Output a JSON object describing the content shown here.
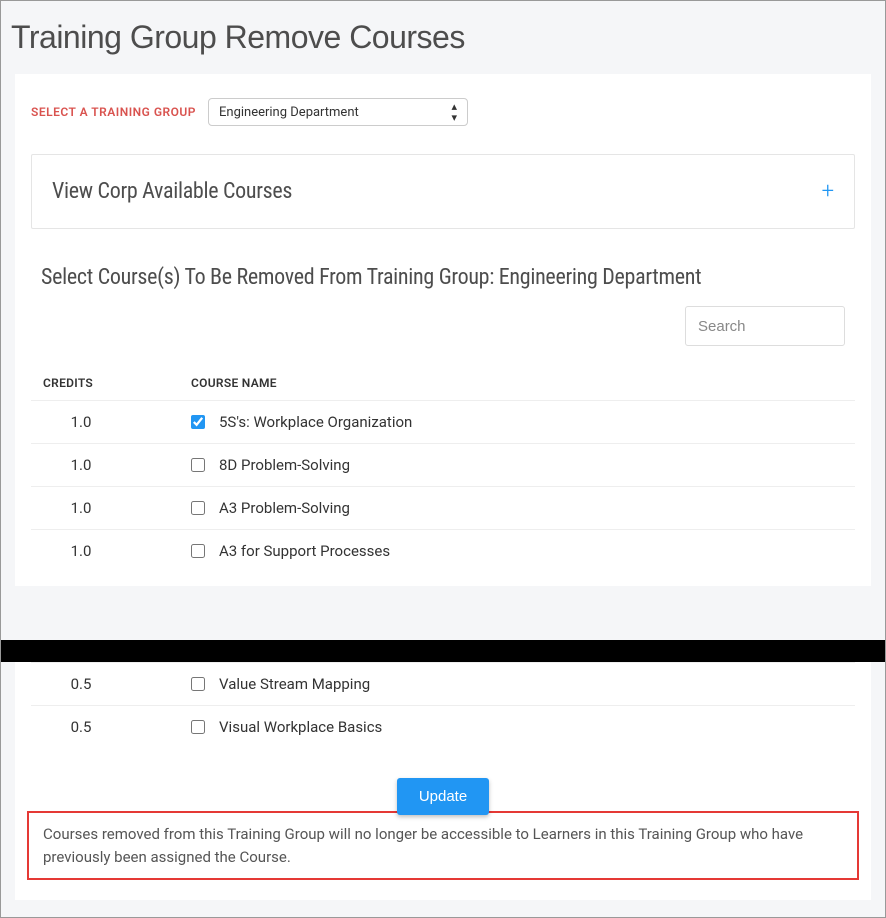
{
  "page": {
    "title": "Training Group Remove Courses"
  },
  "form": {
    "select_group_label": "SELECT A TRAINING GROUP",
    "selected_group": "Engineering Department"
  },
  "accordion": {
    "title": "View Corp Available Courses"
  },
  "section": {
    "title": "Select Course(s) To Be Removed From Training Group: Engineering Department"
  },
  "search": {
    "placeholder": "Search"
  },
  "table": {
    "headers": {
      "credits": "CREDITS",
      "course_name": "COURSE NAME"
    },
    "rows_top": [
      {
        "credits": "1.0",
        "name": "5S's: Workplace Organization",
        "checked": true
      },
      {
        "credits": "1.0",
        "name": "8D Problem-Solving",
        "checked": false
      },
      {
        "credits": "1.0",
        "name": "A3 Problem-Solving",
        "checked": false
      },
      {
        "credits": "1.0",
        "name": "A3 for Support Processes",
        "checked": false
      }
    ],
    "rows_bottom": [
      {
        "credits": "0.5",
        "name": "Value Stream Mapping",
        "checked": false
      },
      {
        "credits": "0.5",
        "name": "Visual Workplace Basics",
        "checked": false
      }
    ]
  },
  "button": {
    "update": "Update"
  },
  "notice": "Courses removed from this Training Group will no longer be accessible to Learners in this Training Group who have previously been assigned the Course."
}
